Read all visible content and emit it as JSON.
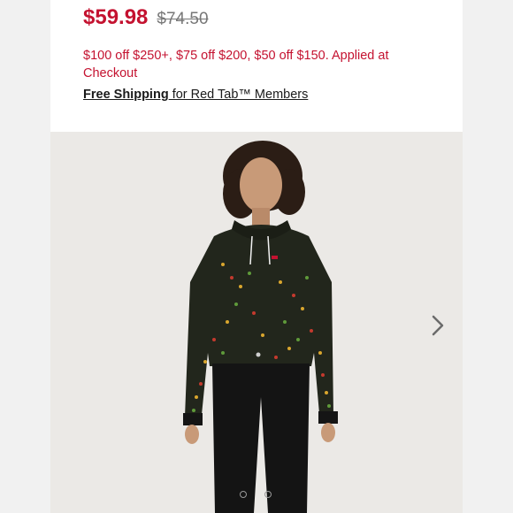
{
  "product": {
    "sale_price": "$59.98",
    "original_price": "$74.50",
    "promo_text": "$100 off $250+, $75 off $200, $50 off $150. Applied at Checkout",
    "shipping_bold": "Free Shipping",
    "shipping_rest": " for Red Tab™ Members"
  },
  "gallery": {
    "image_subject": "model wearing floral print hoodie and black jeans",
    "next_icon": "chevron-right-icon",
    "dots": [
      {
        "state": "inactive"
      },
      {
        "state": "inactive"
      }
    ]
  },
  "colors": {
    "sale_red": "#c41230",
    "strike_gray": "#777777",
    "background": "#f1f1f1"
  }
}
